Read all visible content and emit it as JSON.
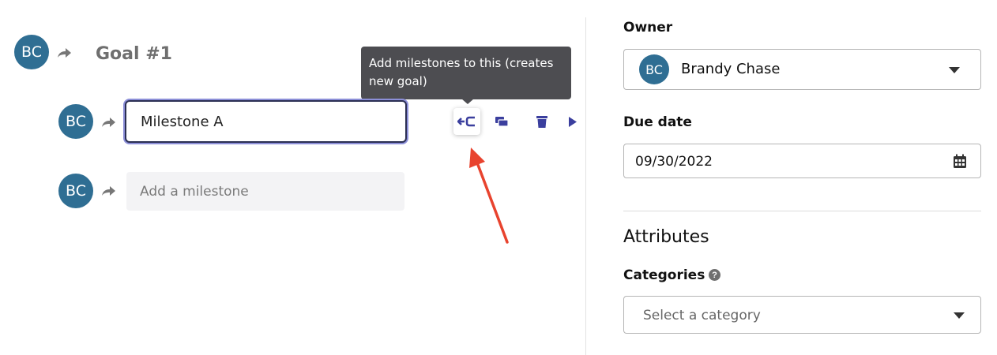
{
  "goal": {
    "avatar_initials": "BC",
    "title": "Goal #1"
  },
  "milestone": {
    "avatar_initials": "BC",
    "value": "Milestone A"
  },
  "new_milestone": {
    "avatar_initials": "BC",
    "placeholder": "Add a milestone"
  },
  "tooltip": {
    "text": "Add milestones to this (creates new goal)"
  },
  "toolbar": {
    "icons": [
      "add-milestones-icon",
      "duplicate-icon",
      "trash-icon",
      "expand-arrow-icon"
    ],
    "accent_color": "#3b3f9e"
  },
  "sidebar": {
    "owner_label": "Owner",
    "owner": {
      "avatar_initials": "BC",
      "name": "Brandy Chase"
    },
    "due_date_label": "Due date",
    "due_date": "09/30/2022",
    "attributes_title": "Attributes",
    "categories_label": "Categories",
    "categories_placeholder": "Select a category"
  },
  "colors": {
    "avatar": "#2f6e93",
    "annotation_arrow": "#e8432e",
    "tooltip_bg": "#4d4d51",
    "focus_ring": "#8c8fd8"
  }
}
